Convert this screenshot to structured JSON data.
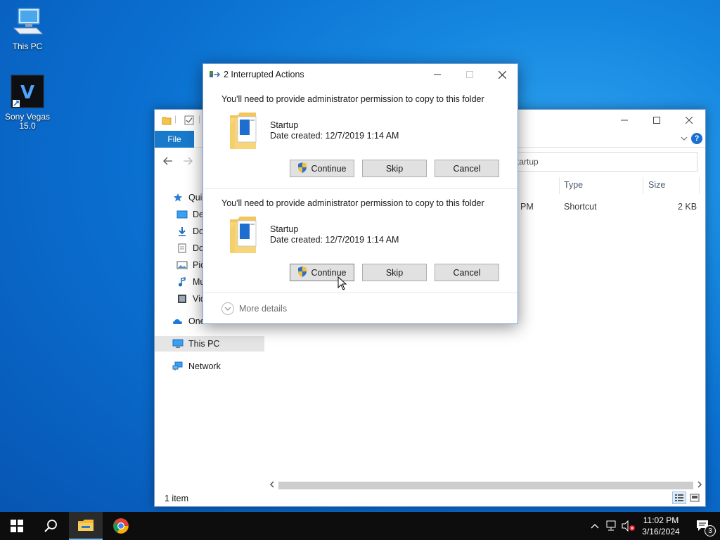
{
  "desktop": {
    "icons": [
      {
        "label": "This PC",
        "icon": "this-pc-icon"
      },
      {
        "label_line1": "Sony Vegas",
        "label_line2": "15.0",
        "icon": "sony-vegas-icon"
      }
    ]
  },
  "explorer": {
    "ribbon": {
      "file_tab": "File",
      "help": "?"
    },
    "address_text": "tartup",
    "nav_items": [
      {
        "label": "Quic",
        "icon": "star-icon"
      },
      {
        "label": "Des",
        "icon": "desktop-icon"
      },
      {
        "label": "Dov",
        "icon": "downloads-icon"
      },
      {
        "label": "Doc",
        "icon": "documents-icon"
      },
      {
        "label": "Pic",
        "icon": "pictures-icon"
      },
      {
        "label": "Mu",
        "icon": "music-icon"
      },
      {
        "label": "Vid",
        "icon": "videos-icon"
      },
      {
        "label": "OneI",
        "icon": "onedrive-icon"
      },
      {
        "label": "This PC",
        "icon": "this-pc-icon",
        "selected": true
      },
      {
        "label": "Network",
        "icon": "network-icon"
      }
    ],
    "columns": {
      "type": "Type",
      "size": "Size"
    },
    "row": {
      "date_fragment": "PM",
      "type": "Shortcut",
      "size": "2 KB"
    },
    "status": "1 item"
  },
  "dialog": {
    "title": "2 Interrupted Actions",
    "items": [
      {
        "message": "You'll need to provide administrator permission to copy to this folder",
        "file_name": "Startup",
        "date_created": "Date created: 12/7/2019 1:14 AM",
        "continue_label": "Continue",
        "skip_label": "Skip",
        "cancel_label": "Cancel"
      },
      {
        "message": "You'll need to provide administrator permission to copy to this folder",
        "file_name": "Startup",
        "date_created": "Date created: 12/7/2019 1:14 AM",
        "continue_label": "Continue",
        "skip_label": "Skip",
        "cancel_label": "Cancel"
      }
    ],
    "more_details": "More details"
  },
  "taskbar": {
    "clock_time": "11:02 PM",
    "clock_date": "3/16/2024",
    "notification_count": "3"
  },
  "colors": {
    "accent": "#1979ca",
    "taskbar": "#0d0d0d",
    "desktop": "#0a6fd0"
  }
}
